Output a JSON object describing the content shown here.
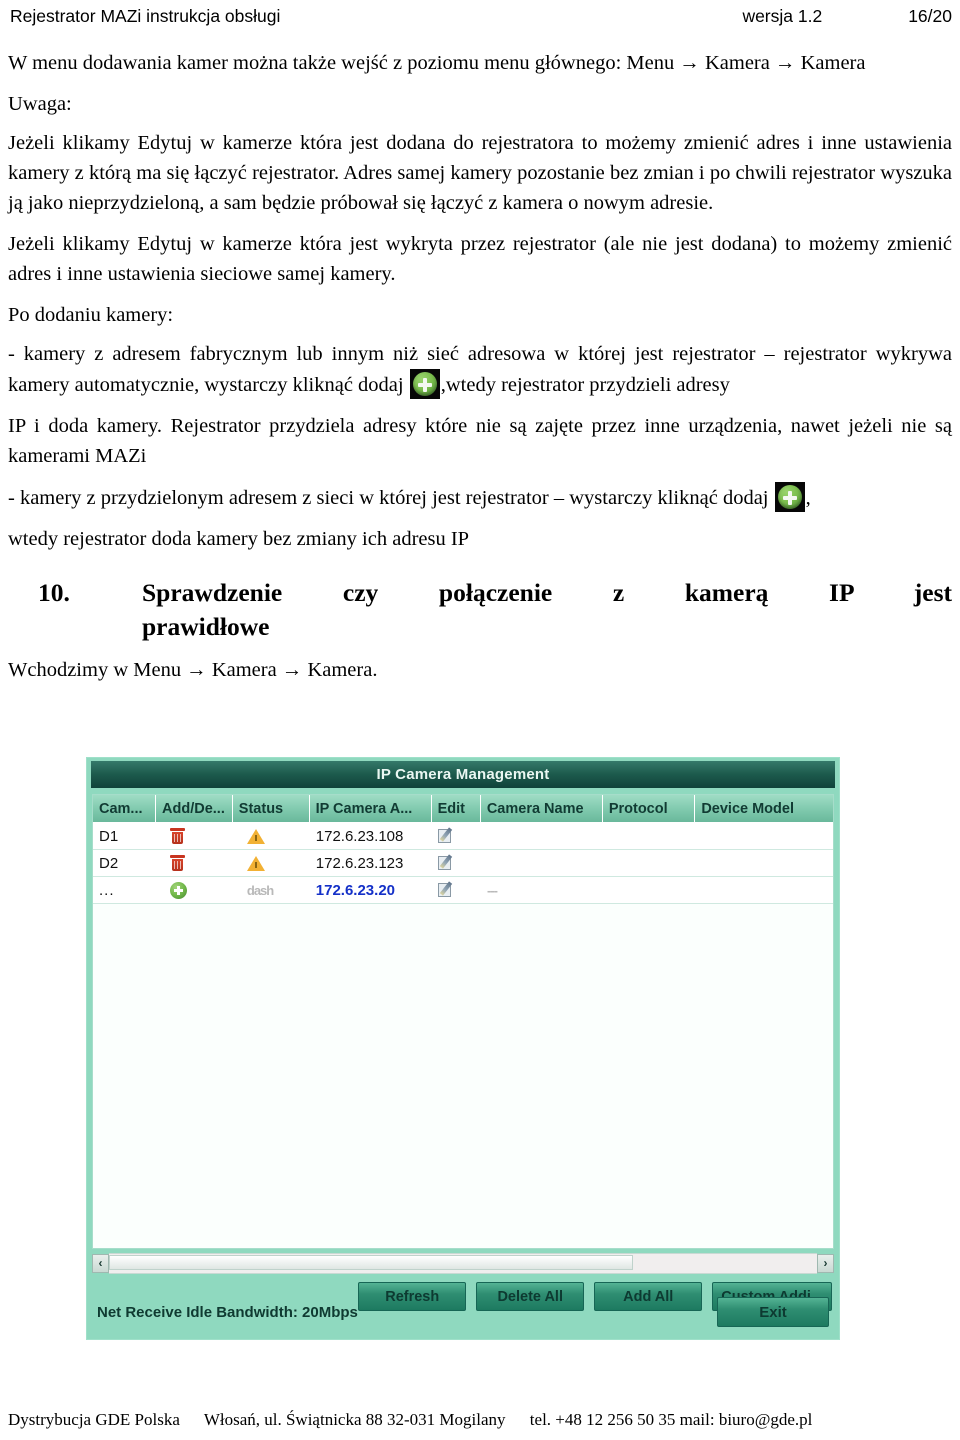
{
  "header": {
    "title": "Rejestrator MAZi instrukcja obsługi",
    "version": "wersja 1.2",
    "page": "16/20"
  },
  "body": {
    "p1": "W menu dodawania kamer można także wejść z poziomu menu głównego: Menu → Kamera → Kamera",
    "p2": "Uwaga:",
    "p3": "Jeżeli klikamy Edytuj w kamerze która jest dodana do rejestratora to możemy zmienić adres i inne ustawienia kamery z którą ma się łączyć rejestrator. Adres samej kamery pozostanie bez zmian i po chwili rejestrator wyszuka ją jako nieprzydzieloną, a sam będzie próbował się łączyć z kamera o nowym adresie.",
    "p4": "Jeżeli klikamy Edytuj w kamerze która jest wykryta przez rejestrator (ale nie jest dodana) to możemy zmienić adres i inne ustawienia sieciowe samej kamery.",
    "p5": "Po dodaniu kamery:",
    "p6a": "- kamery z adresem fabrycznym lub innym niż sieć adresowa w której jest rejestrator – rejestrator wykrywa kamery automatycznie, wystarczy kliknąć dodaj ",
    "p6b": ",wtedy rejestrator przydzieli adresy",
    "p7": "IP i doda kamery. Rejestrator przydziela adresy które nie są zajęte przez inne urządzenia, nawet jeżeli nie są kamerami MAZi",
    "p8a": "- kamery z przydzielonym adresem z sieci w której jest rejestrator – wystarczy kliknąć dodaj ",
    "p8b": ",",
    "p9": "wtedy rejestrator doda kamery bez zmiany ich adresu IP",
    "heading_number": "10.",
    "heading_line1": "Sprawdzenie czy połączenie z kamerą IP jest",
    "heading_line2": "prawidłowe",
    "p10": "Wchodzimy w Menu → Kamera → Kamera."
  },
  "dvr": {
    "title": "IP Camera Management",
    "columns": [
      "Cam...",
      "Add/De...",
      "Status",
      "IP Camera A...",
      "Edit",
      "Camera Name",
      "Protocol",
      "Device Model"
    ],
    "rows": [
      {
        "camera": "D1",
        "add_delete_icon": "trash-icon",
        "status_icon": "warning-triangle-icon",
        "ip": "172.6.23.108",
        "ip_highlight": false,
        "edit_icon": "edit-pencil-icon",
        "camera_name": "",
        "protocol": "",
        "device_model": ""
      },
      {
        "camera": "D2",
        "add_delete_icon": "trash-icon",
        "status_icon": "warning-triangle-icon",
        "ip": "172.6.23.123",
        "ip_highlight": false,
        "edit_icon": "edit-pencil-icon",
        "camera_name": "",
        "protocol": "",
        "device_model": ""
      },
      {
        "camera": "...",
        "add_delete_icon": "add-plus-icon",
        "status_icon": "dash",
        "ip": "172.6.23.20",
        "ip_highlight": true,
        "edit_icon": "edit-pencil-icon",
        "camera_name": "---",
        "protocol": "",
        "device_model": ""
      }
    ],
    "scroll_left_glyph": "‹",
    "scroll_right_glyph": "›",
    "buttons": {
      "refresh": "Refresh",
      "delete_all": "Delete All",
      "add_all": "Add All",
      "custom_adding": "Custom Addi...",
      "exit": "Exit"
    },
    "status_text": "Net Receive Idle Bandwidth: 20Mbps",
    "colors": {
      "panel_bg": "#8fd9bf",
      "titlebar": "#1d5b4d",
      "header_row": "#7fc9ad",
      "button": "#2f8e72",
      "ip_highlight": "#1430c8",
      "trash": "#c8341f",
      "warning": "#f2b134",
      "add_plus": "#72b84a"
    }
  },
  "footer": {
    "company": "Dystrybucja GDE Polska",
    "address": "Włosań, ul. Świątnicka 88 32-031 Mogilany",
    "contact": "tel. +48 12 256 50 35 mail: biuro@gde.pl"
  }
}
